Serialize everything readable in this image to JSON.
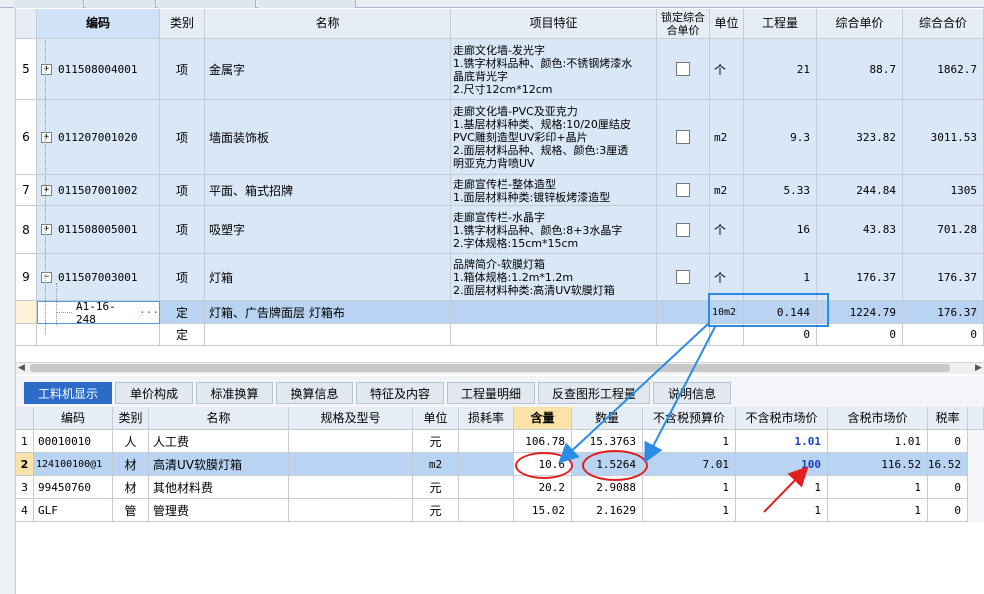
{
  "top_tabs": [
    "",
    "",
    "",
    ""
  ],
  "upper_grid": {
    "headers": {
      "code": "编码",
      "type": "类别",
      "name": "名称",
      "feature": "项目特征",
      "locked_price": "锁定综合\n合单价",
      "unit": "单位",
      "qty": "工程量",
      "unit_price": "综合单价",
      "total": "综合合价"
    },
    "rows": [
      {
        "idx": "5",
        "code": "011508004001",
        "type": "项",
        "name": "金属字",
        "feature": "走廊文化墙-发光字\n1.镌字材料品种、颜色:不锈钢烤漆水\n晶底背光字\n2.尺寸12cm*12cm",
        "unit": "个",
        "qty": "21",
        "price": "88.7",
        "total": "1862.7"
      },
      {
        "idx": "6",
        "code": "011207001020",
        "type": "项",
        "name": "墙面装饰板",
        "feature": "走廊文化墙-PVC及亚克力\n1.基层材料种类、规格:10/20厘结皮\nPVC雕刻造型UV彩印+晶片\n2.面层材料品种、规格、颜色:3厘透\n明亚克力背喷UV",
        "unit": "m2",
        "qty": "9.3",
        "price": "323.82",
        "total": "3011.53"
      },
      {
        "idx": "7",
        "code": "011507001002",
        "type": "项",
        "name": "平面、箱式招牌",
        "feature": "走廊宣传栏-整体造型\n1.面层材料种类:镀锌板烤漆造型",
        "unit": "m2",
        "qty": "5.33",
        "price": "244.84",
        "total": "1305"
      },
      {
        "idx": "8",
        "code": "011508005001",
        "type": "项",
        "name": "吸塑字",
        "feature": "走廊宣传栏-水晶字\n1.镌字材料品种、颜色:8+3水晶字\n2.字体规格:15cm*15cm",
        "unit": "个",
        "qty": "16",
        "price": "43.83",
        "total": "701.28"
      },
      {
        "idx": "9",
        "code": "011507003001",
        "type": "项",
        "name": "灯箱",
        "feature": "品牌简介-软膜灯箱\n1.箱体规格:1.2m*1.2m\n2.面层材料种类:高清UV软膜灯箱",
        "unit": "个",
        "qty": "1",
        "price": "176.37",
        "total": "176.37"
      }
    ],
    "quota_row": {
      "code": "A1-16-248",
      "ellipsis": "···",
      "type": "定",
      "name": "灯箱、广告牌面层 灯箱布",
      "unit": "10m2",
      "qty": "0.144",
      "price": "1224.79",
      "total": "176.37"
    },
    "empty_row": {
      "type": "定",
      "qty": "0",
      "price": "0",
      "total": "0"
    }
  },
  "lower_tabs": [
    "工料机显示",
    "单价构成",
    "标准换算",
    "换算信息",
    "特征及内容",
    "工程量明细",
    "反查图形工程量",
    "说明信息"
  ],
  "lower_grid": {
    "headers": {
      "code": "编码",
      "type": "类别",
      "name": "名称",
      "spec": "规格及型号",
      "unit": "单位",
      "loss": "损耗率",
      "content": "含量",
      "quantity": "数量",
      "budget": "不含税预算价",
      "market": "不含税市场价",
      "market_tax": "含税市场价",
      "tax": "税率"
    },
    "rows": [
      {
        "idx": "1",
        "code": "00010010",
        "type": "人",
        "name": "人工费",
        "unit": "元",
        "content": "106.78",
        "quantity": "15.3763",
        "budget": "1",
        "market": "1.01",
        "market_tax": "1.01",
        "tax": "0"
      },
      {
        "idx": "2",
        "code": "124100100@1",
        "type": "材",
        "name": "高清UV软膜灯箱",
        "unit": "m2",
        "content": "10.6",
        "quantity": "1.5264",
        "budget": "7.01",
        "market": "100",
        "market_tax": "116.52",
        "tax": "16.52"
      },
      {
        "idx": "3",
        "code": "99450760",
        "type": "材",
        "name": "其他材料费",
        "unit": "元",
        "content": "20.2",
        "quantity": "2.9088",
        "budget": "1",
        "market": "1",
        "market_tax": "1",
        "tax": "0"
      },
      {
        "idx": "4",
        "code": "GLF",
        "type": "管",
        "name": "管理费",
        "unit": "元",
        "content": "15.02",
        "quantity": "2.1629",
        "budget": "1",
        "market": "1",
        "market_tax": "1",
        "tax": "0"
      }
    ]
  },
  "colors": {
    "accent": "#2c6cc8",
    "highlight": "#2b8ce6",
    "annotation": "#e02020",
    "row_blue": "#d9e7f7"
  }
}
